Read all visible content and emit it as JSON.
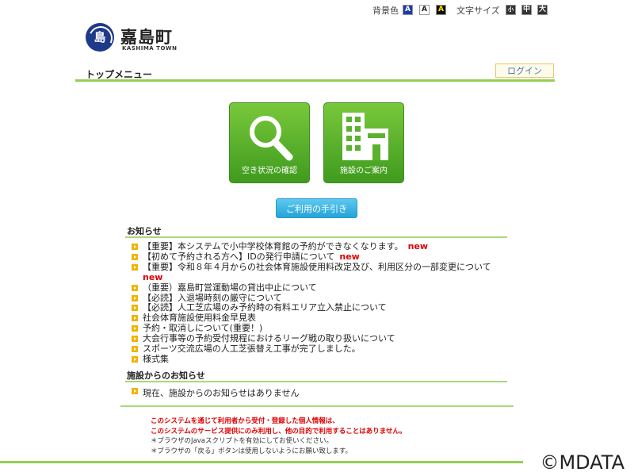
{
  "header": {
    "bg_label": "背景色",
    "bg_options": [
      "A",
      "A",
      "A"
    ],
    "font_label": "文字サイズ",
    "font_options": [
      "小",
      "中",
      "大"
    ],
    "logo_title": "嘉島町",
    "logo_sub": "KASHIMA TOWN",
    "logo_mark": "島"
  },
  "menu": {
    "title": "トップメニュー",
    "login": "ログイン"
  },
  "main_buttons": {
    "availability": "空き状況の確認",
    "facilities": "施設のご案内",
    "guide": "ご利用の手引き"
  },
  "news": {
    "title": "お知らせ",
    "items": [
      {
        "text": "【重要】本システムで小中学校体育館の予約ができなくなります。",
        "badge": "new"
      },
      {
        "text": "【初めて予約される方へ】IDの発行申請について",
        "badge": "new"
      },
      {
        "text": "【重要】令和８年４月からの社会体育施設使用料改定及び、利用区分の一部変更について",
        "badge": ""
      },
      {
        "text": "（重要）嘉島町営運動場の貸出中止について",
        "badge": ""
      },
      {
        "text": "【必読】入退場時刻の厳守について",
        "badge": ""
      },
      {
        "text": "【必読】人工芝広場のみ予約時の有料エリア立入禁止について",
        "badge": ""
      },
      {
        "text": "社会体育施設使用料金早見表",
        "badge": ""
      },
      {
        "text": "予約・取消しについて(重要！)",
        "badge": ""
      },
      {
        "text": "大会行事等の予約受付規程におけるリーグ戦の取り扱いについて",
        "badge": ""
      },
      {
        "text": "スポーツ交流広場の人工芝張替え工事が完了しました。",
        "badge": ""
      },
      {
        "text": "様式集",
        "badge": ""
      }
    ],
    "wrapped_badge": "new"
  },
  "facility_news": {
    "title": "施設からのお知らせ",
    "message": "現在、施設からのお知らせはありません"
  },
  "footer": {
    "privacy_1": "このシステムを通じて利用者から受付・登録した個人情報は、",
    "privacy_2": "このシステムのサービス提供にのみ利用し、他の目的で利用することはありません。",
    "note_1": "＊ブラウザのJavaスクリプトを有効にしてお使いください。",
    "note_2": "＊ブラウザの「戻る」ボタンは使用しないようにお願い致します。",
    "copyright": "©MDATA"
  },
  "colors": {
    "green_rule": "#93cf55",
    "green_button": "#5bb22c",
    "blue_button": "#3ab4e6",
    "new_red": "#e00000",
    "bullet": "#f0b400"
  }
}
